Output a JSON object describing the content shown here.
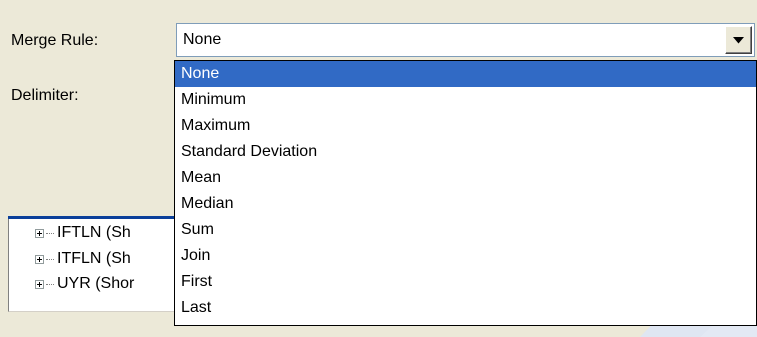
{
  "form": {
    "merge_rule_label": "Merge Rule:",
    "delimiter_label": "Delimiter:"
  },
  "combo": {
    "value": "None",
    "arrow_icon": "chevron-down-icon"
  },
  "dropdown": {
    "selected_index": 0,
    "options": [
      "None",
      "Minimum",
      "Maximum",
      "Standard Deviation",
      "Mean",
      "Median",
      "Sum",
      "Join",
      "First",
      "Last"
    ]
  },
  "tree": {
    "items": [
      {
        "label": "IFTLN (Sh"
      },
      {
        "label": "ITFLN (Sh"
      },
      {
        "label": "UYR (Shor"
      }
    ]
  },
  "colors": {
    "selection": "#316ac5",
    "accent_line": "#0a3f9a",
    "window_bg": "#ece9d8"
  }
}
